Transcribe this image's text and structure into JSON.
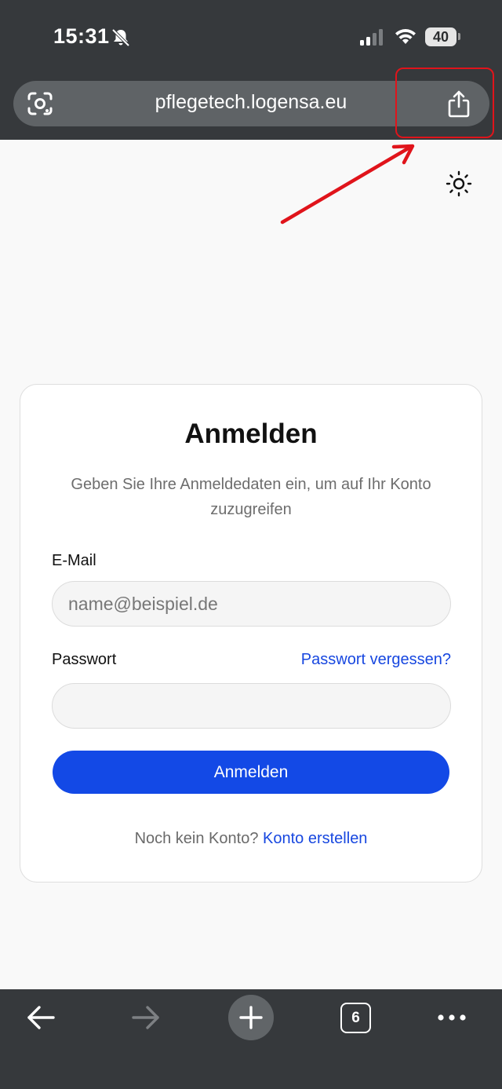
{
  "status_bar": {
    "time": "15:31",
    "battery": "40",
    "icons": [
      "bell-slash-icon",
      "signal-icon",
      "wifi-icon",
      "battery-icon"
    ]
  },
  "browser": {
    "url": "pflegetech.logensa.eu",
    "icons": [
      "lens-icon",
      "share-icon"
    ],
    "tab_count": "6",
    "toolbar_icons": [
      "back-icon",
      "forward-icon",
      "plus-icon",
      "tabs-icon",
      "more-icon"
    ]
  },
  "annotation": {
    "color": "#e0141b",
    "target": "share-icon"
  },
  "login": {
    "title": "Anmelden",
    "description": "Geben Sie Ihre Anmeldedaten ein, um auf Ihr Konto zuzugreifen",
    "email_label": "E-Mail",
    "email_placeholder": "name@beispiel.de",
    "email_value": "",
    "password_label": "Passwort",
    "password_value": "",
    "forgot_link": "Passwort vergessen?",
    "submit_label": "Anmelden",
    "signup_prompt": "Noch kein Konto?",
    "signup_link": "Konto erstellen"
  },
  "colors": {
    "primary": "#1349e6",
    "link": "#1747e0",
    "chrome": "#36393c"
  }
}
